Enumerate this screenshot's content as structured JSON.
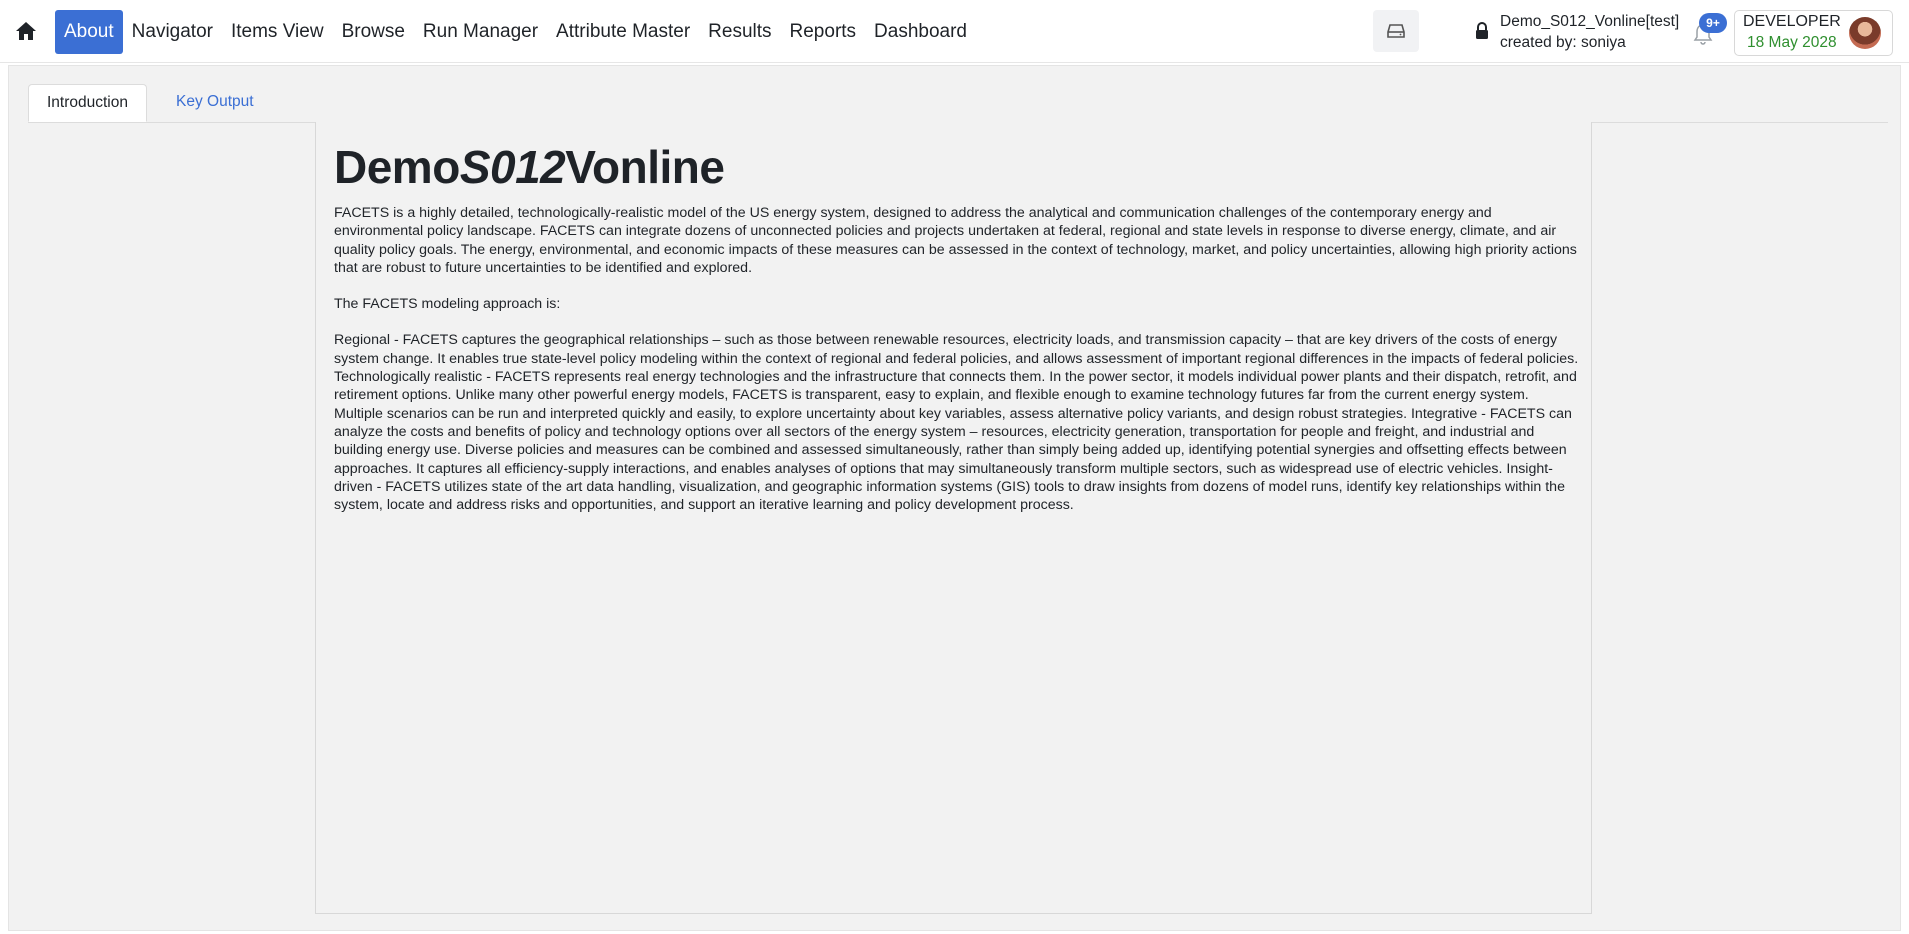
{
  "navbar": {
    "home_icon": "home-icon",
    "items": [
      {
        "label": "About",
        "active": true
      },
      {
        "label": "Navigator",
        "active": false
      },
      {
        "label": "Items View",
        "active": false
      },
      {
        "label": "Browse",
        "active": false
      },
      {
        "label": "Run Manager",
        "active": false
      },
      {
        "label": "Attribute Master",
        "active": false
      },
      {
        "label": "Results",
        "active": false
      },
      {
        "label": "Reports",
        "active": false
      },
      {
        "label": "Dashboard",
        "active": false
      }
    ],
    "db_icon": "database-drive-icon",
    "project": {
      "lock_icon": "lock-icon",
      "name": "Demo_S012_Vonline[test]",
      "created_by": "created by: soniya"
    },
    "notifications": {
      "icon": "bell-icon",
      "badge": "9+"
    },
    "user": {
      "role": "DEVELOPER",
      "date": "18 May 2028"
    },
    "colors": {
      "accent": "#3b6fd4",
      "date_green": "#2f8f2f"
    }
  },
  "tabs": [
    {
      "label": "Introduction",
      "active": true
    },
    {
      "label": "Key Output",
      "active": false
    }
  ],
  "content": {
    "title_part1": "Demo",
    "title_part2": "S012",
    "title_part3": "Vonline",
    "paragraph1": "FACETS is a highly detailed, technologically-realistic model of the US energy system, designed to address the analytical and communication challenges of the contemporary energy and environmental policy landscape. FACETS can integrate dozens of unconnected policies and projects undertaken at federal, regional and state levels in response to diverse energy, climate, and air quality policy goals. The energy, environmental, and economic impacts of these measures can be assessed in the context of technology, market, and policy uncertainties, allowing high priority actions that are robust to future uncertainties to be identified and explored.",
    "paragraph2": "The FACETS modeling approach is:",
    "paragraph3": "Regional - FACETS captures the geographical relationships – such as those between renewable resources, electricity loads, and transmission capacity – that are key drivers of the costs of energy system change. It enables true state-level policy modeling within the context of regional and federal policies, and allows assessment of important regional differences in the impacts of federal policies. Technologically realistic - FACETS represents real energy technologies and the infrastructure that connects them. In the power sector, it models individual power plants and their dispatch, retrofit, and retirement options. Unlike many other powerful energy models, FACETS is transparent, easy to explain, and flexible enough to examine technology futures far from the current energy system. Multiple scenarios can be run and interpreted quickly and easily, to explore uncertainty about key variables, assess alternative policy variants, and design robust strategies. Integrative - FACETS can analyze the costs and benefits of policy and technology options over all sectors of the energy system – resources, electricity generation, transportation for people and freight, and industrial and building energy use. Diverse policies and measures can be combined and assessed simultaneously, rather than simply being added up, identifying potential synergies and offsetting effects between approaches. It captures all efficiency-supply interactions, and enables analyses of options that may simultaneously transform multiple sectors, such as widespread use of electric vehicles. Insight-driven - FACETS utilizes state of the art data handling, visualization, and geographic information systems (GIS) tools to draw insights from dozens of model runs, identify key relationships within the system, locate and address risks and opportunities, and support an iterative learning and policy development process."
  }
}
